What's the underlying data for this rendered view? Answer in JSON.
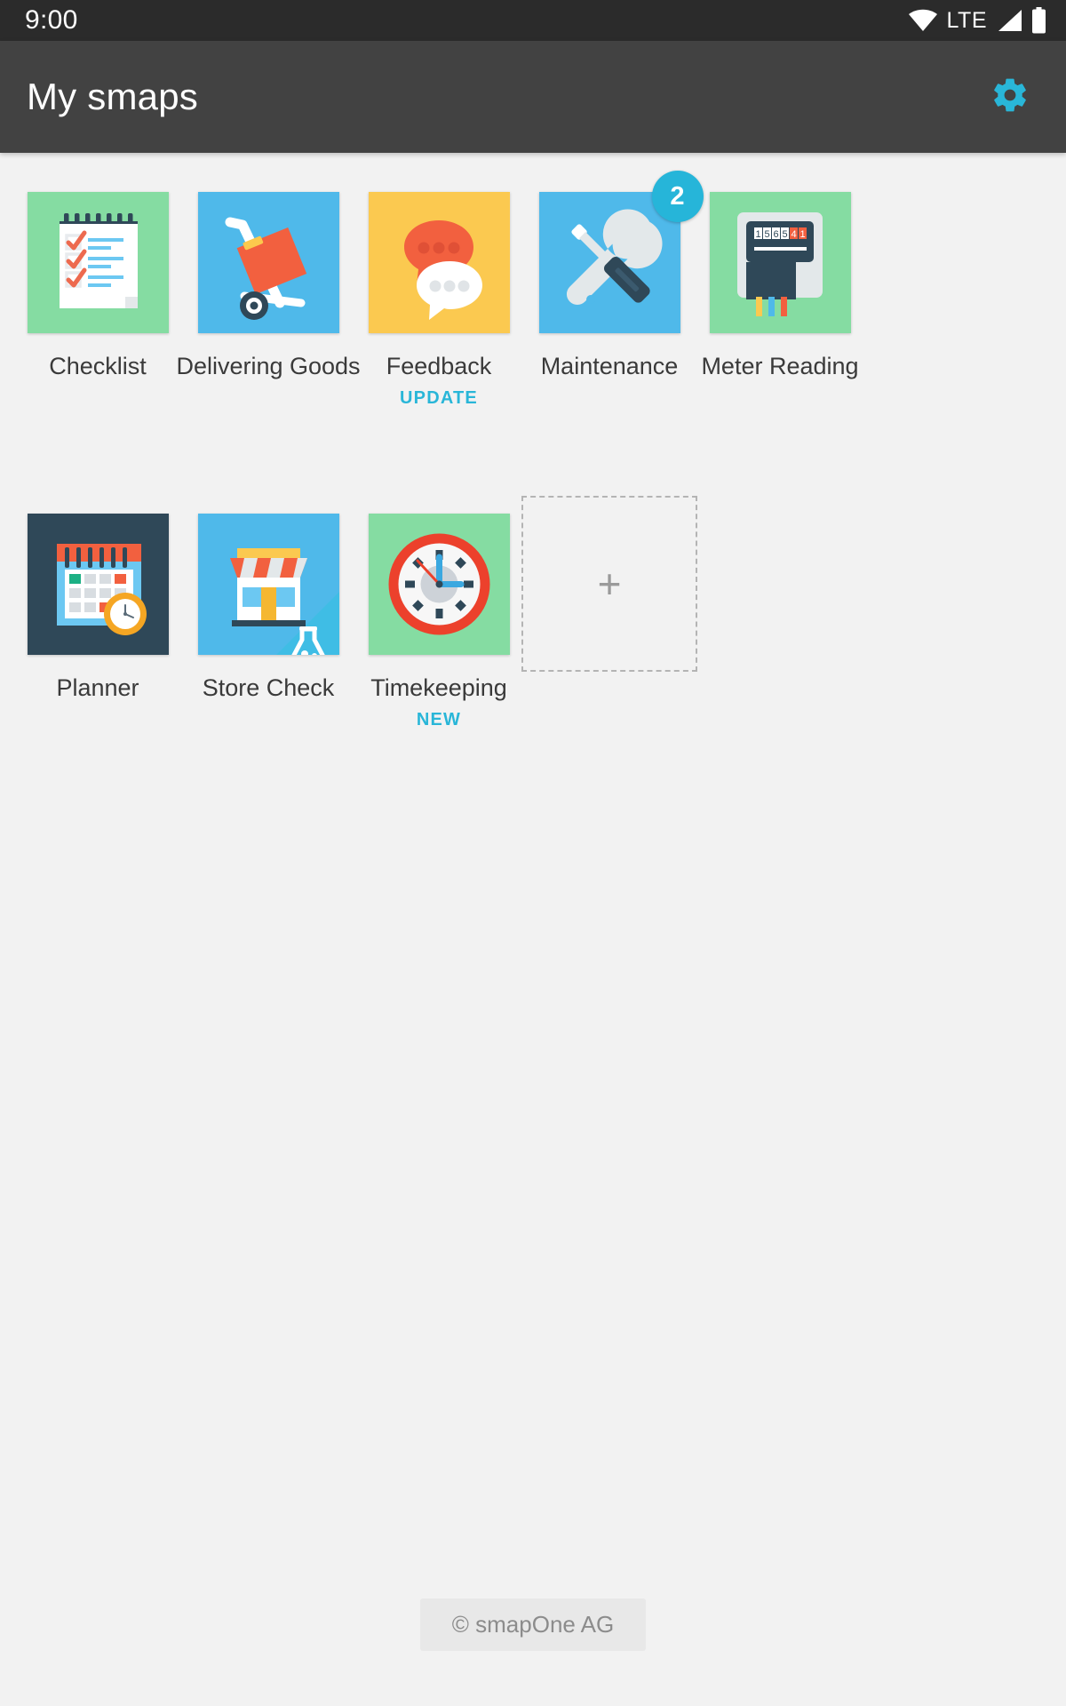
{
  "status_bar": {
    "time": "9:00",
    "network_label": "LTE",
    "icons": [
      "wifi-icon",
      "signal-icon",
      "battery-icon"
    ]
  },
  "app_bar": {
    "title": "My smaps",
    "settings_icon": "gear-icon",
    "accent_color": "#29b6d8",
    "background_color": "#424242"
  },
  "grid": {
    "rows": [
      {
        "items": [
          {
            "label": "Checklist",
            "icon": "checklist-notepad-icon",
            "tile_color": "#85dca2",
            "badge": null,
            "sub": null
          },
          {
            "label": "Delivering Goods",
            "icon": "hand-truck-icon",
            "tile_color": "#4fb9ea",
            "badge": null,
            "sub": null
          },
          {
            "label": "Feedback",
            "icon": "speech-bubbles-icon",
            "tile_color": "#fbc950",
            "badge": null,
            "sub": "UPDATE"
          },
          {
            "label": "Maintenance",
            "icon": "wrench-screwdriver-icon",
            "tile_color": "#4fb9ea",
            "badge": "2",
            "sub": null
          },
          {
            "label": "Meter Reading",
            "icon": "electric-meter-icon",
            "tile_color": "#85dca2",
            "badge": null,
            "sub": null
          }
        ]
      },
      {
        "items": [
          {
            "label": "Planner",
            "icon": "calendar-clock-icon",
            "tile_color": "#2f4858",
            "badge": null,
            "sub": null
          },
          {
            "label": "Store Check",
            "icon": "storefront-flask-icon",
            "tile_color": "#4fb9ea",
            "badge": null,
            "sub": null
          },
          {
            "label": "Timekeeping",
            "icon": "wall-clock-icon",
            "tile_color": "#85dca2",
            "badge": null,
            "sub": "NEW"
          }
        ],
        "add_tile": {
          "icon": "plus-icon",
          "glyph": "+"
        }
      }
    ]
  },
  "meter": {
    "digits": [
      "1",
      "5",
      "6",
      "5",
      "4",
      "1"
    ]
  },
  "footer": {
    "copyright": "© smapOne AG"
  }
}
